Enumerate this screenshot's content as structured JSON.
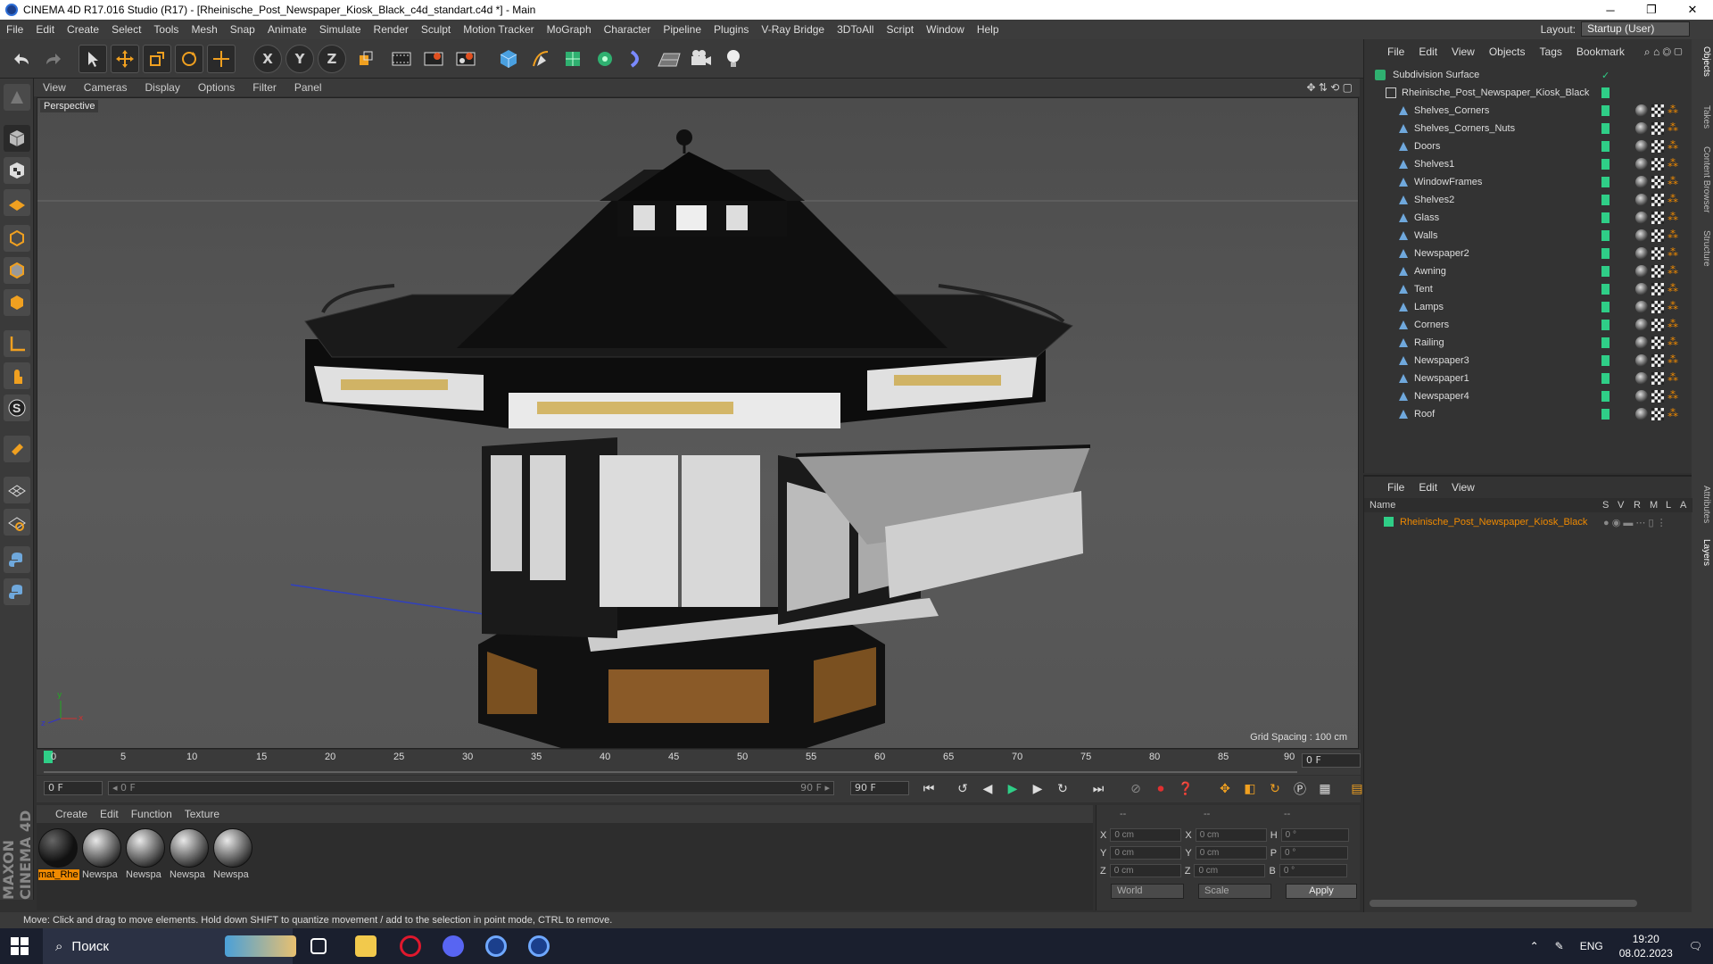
{
  "window": {
    "title": "CINEMA 4D R17.016 Studio (R17) - [Rheinische_Post_Newspaper_Kiosk_Black_c4d_standart.c4d *] - Main",
    "minimize": "─",
    "maximize": "❐",
    "close": "✕"
  },
  "menubar": {
    "items": [
      "File",
      "Edit",
      "Create",
      "Select",
      "Tools",
      "Mesh",
      "Snap",
      "Animate",
      "Simulate",
      "Render",
      "Sculpt",
      "Motion Tracker",
      "MoGraph",
      "Character",
      "Pipeline",
      "Plugins",
      "V-Ray Bridge",
      "3DToAll",
      "Script",
      "Window",
      "Help"
    ],
    "layout_label": "Layout:",
    "layout_value": "Startup (User)"
  },
  "toolbar": {
    "axis_x": "X",
    "axis_y": "Y",
    "axis_z": "Z"
  },
  "viewport": {
    "menu": [
      "View",
      "Cameras",
      "Display",
      "Options",
      "Filter",
      "Panel"
    ],
    "label": "Perspective",
    "grid_spacing": "Grid Spacing : 100 cm",
    "axis_y": "y",
    "axis_x": "x",
    "axis_z": "z"
  },
  "timeline": {
    "ticks": [
      "0",
      "5",
      "10",
      "15",
      "20",
      "25",
      "30",
      "35",
      "40",
      "45",
      "50",
      "55",
      "60",
      "65",
      "70",
      "75",
      "80",
      "85",
      "90"
    ],
    "current_frame": "0 F",
    "start_field": "0 F",
    "range_start": "◂ 0 F",
    "range_end": "90 F ▸",
    "end_field": "90 F"
  },
  "material_manager": {
    "menu": [
      "Create",
      "Edit",
      "Function",
      "Texture"
    ],
    "materials": [
      "mat_Rhe",
      "Newspa",
      "Newspa",
      "Newspa",
      "Newspa"
    ]
  },
  "coordinates": {
    "header": [
      "--",
      "--",
      "--"
    ],
    "rows": [
      {
        "l1": "X",
        "v1": "0 cm",
        "l2": "X",
        "v2": "0 cm",
        "l3": "H",
        "v3": "0 °"
      },
      {
        "l1": "Y",
        "v1": "0 cm",
        "l2": "Y",
        "v2": "0 cm",
        "l3": "P",
        "v3": "0 °"
      },
      {
        "l1": "Z",
        "v1": "0 cm",
        "l2": "Z",
        "v2": "0 cm",
        "l3": "B",
        "v3": "0 °"
      }
    ],
    "space": "World",
    "mode": "Scale",
    "apply": "Apply"
  },
  "status": "Move: Click and drag to move elements. Hold down SHIFT to quantize movement / add to the selection in point mode, CTRL to remove.",
  "object_manager": {
    "menu": [
      "File",
      "Edit",
      "View",
      "Objects",
      "Tags",
      "Bookmark"
    ],
    "root": "Subdivision Surface",
    "group": "Rheinische_Post_Newspaper_Kiosk_Black",
    "children": [
      "Shelves_Corners",
      "Shelves_Corners_Nuts",
      "Doors",
      "Shelves1",
      "WindowFrames",
      "Shelves2",
      "Glass",
      "Walls",
      "Newspaper2",
      "Awning",
      "Tent",
      "Lamps",
      "Corners",
      "Railing",
      "Newspaper3",
      "Newspaper1",
      "Newspaper4",
      "Roof"
    ]
  },
  "side_tabs": [
    "Objects",
    "Takes",
    "Content Browser",
    "Structure",
    "Attributes",
    "Layers"
  ],
  "layer_manager": {
    "menu": [
      "File",
      "Edit",
      "View"
    ],
    "columns": [
      "Name",
      "S",
      "V",
      "R",
      "M",
      "L",
      "A"
    ],
    "layer_name": "Rheinische_Post_Newspaper_Kiosk_Black",
    "layer_color": "#2fce87"
  },
  "taskbar": {
    "search_placeholder": "Поиск",
    "language": "ENG",
    "time": "19:20",
    "date": "08.02.2023"
  },
  "colors": {
    "accent_orange": "#f08a00",
    "layer_green": "#2fce87",
    "panel_bg": "#333333"
  }
}
